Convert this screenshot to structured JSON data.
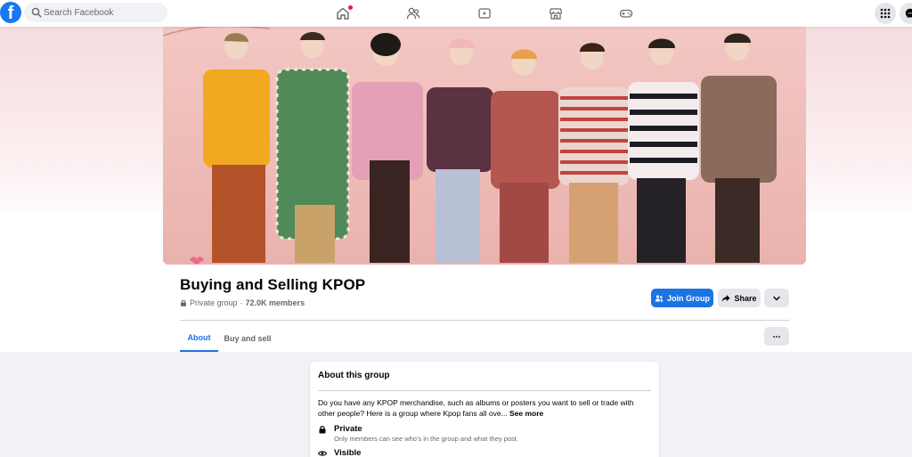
{
  "nav": {
    "logo_letter": "f",
    "search_placeholder": "Search Facebook"
  },
  "group": {
    "name": "Buying and Selling KPOP",
    "privacy": "Private group",
    "separator": "·",
    "members": "72.0K members"
  },
  "actions": {
    "join_label": "Join Group",
    "share_label": "Share"
  },
  "tabs": [
    {
      "label": "About",
      "active": true
    },
    {
      "label": "Buy and sell",
      "active": false
    }
  ],
  "about_card": {
    "title": "About this group",
    "description": "Do you have any KPOP merchandise, such as albums or posters you want to sell or trade with other people? Here is a group where Kpop fans all ove...",
    "see_more": "See more",
    "features": [
      {
        "icon": "lock-icon",
        "title": "Private",
        "subtitle": "Only members can see who's in the group and what they post."
      },
      {
        "icon": "eye-icon",
        "title": "Visible",
        "subtitle": ""
      }
    ]
  },
  "colors": {
    "brand": "#1877f2",
    "primary_button": "#1b74e4",
    "secondary_button": "#e4e6eb",
    "page_bg": "#f0f2f5"
  }
}
